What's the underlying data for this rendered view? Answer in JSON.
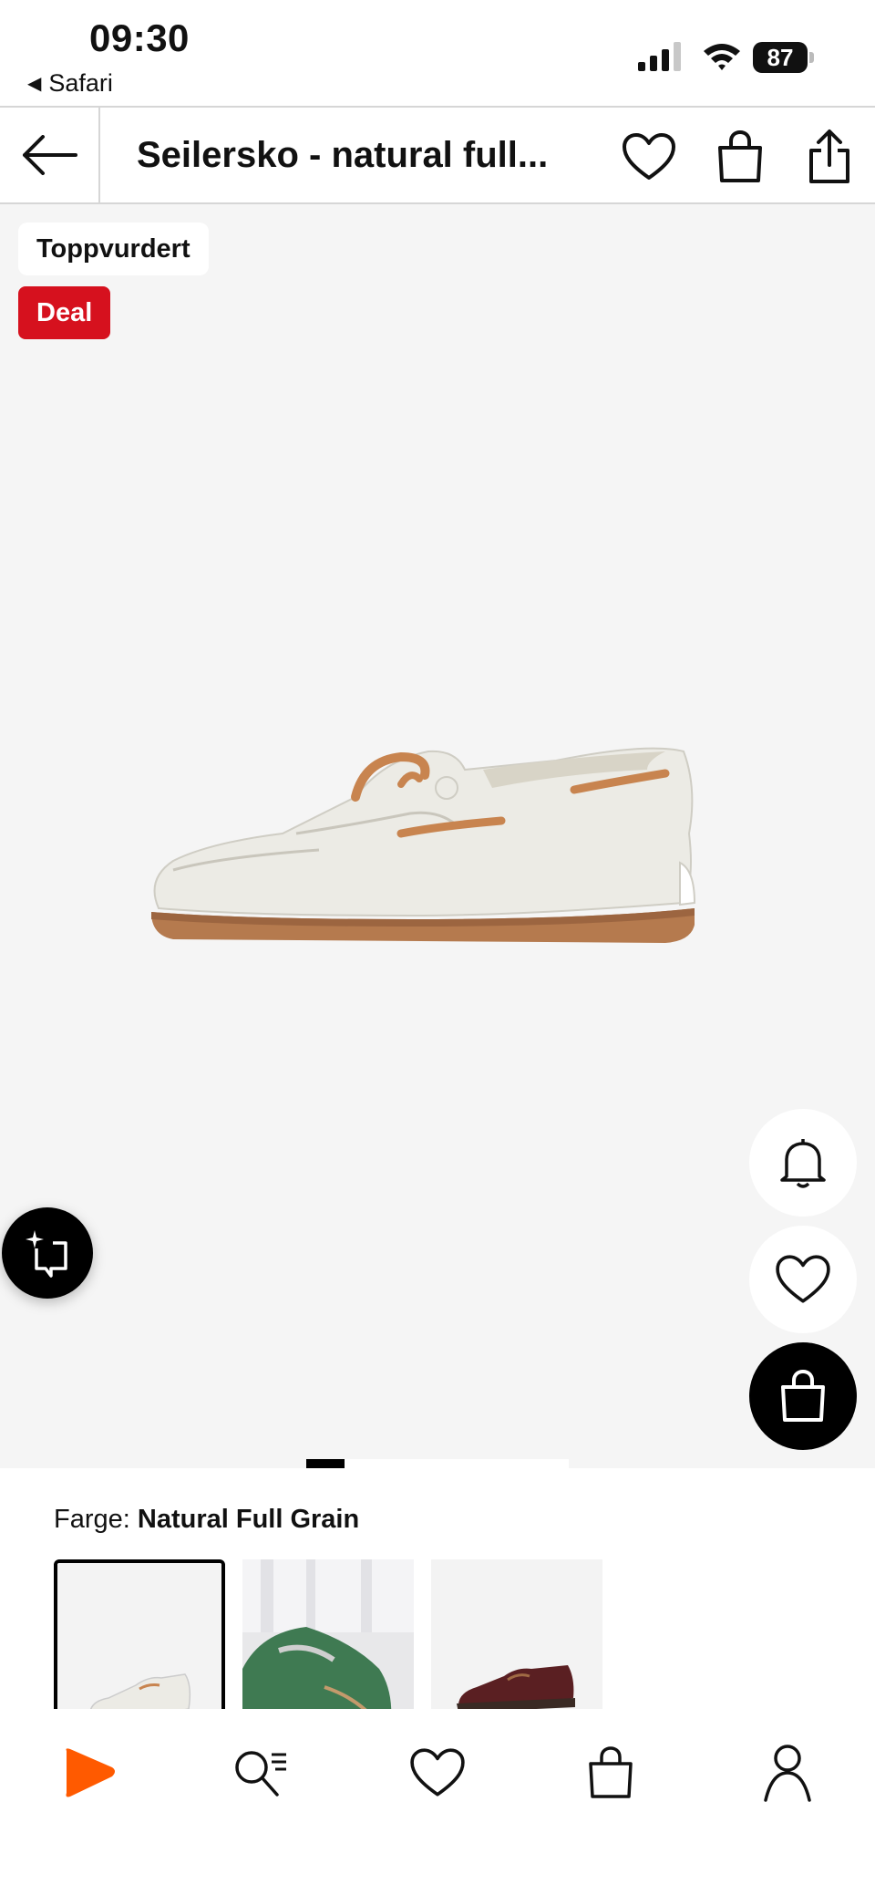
{
  "status": {
    "time": "09:30",
    "back_app": "Safari",
    "battery": "87"
  },
  "header": {
    "title": "Seilersko - natural full..."
  },
  "product": {
    "badges": {
      "top_rated": "Toppvurdert",
      "deal": "Deal"
    },
    "image_count_active": 1
  },
  "colors": {
    "label": "Farge:",
    "selected": "Natural Full Grain",
    "swatches": [
      "natural-full-grain",
      "green",
      "burgundy"
    ]
  },
  "tabbar": {
    "items": [
      "home-icon",
      "search-icon",
      "wishlist-icon",
      "bag-icon",
      "profile-icon"
    ]
  },
  "colors_palette": {
    "deal_red": "#d6111e",
    "brand_orange": "#ff5a00",
    "gallery_bg": "#f5f5f5"
  }
}
